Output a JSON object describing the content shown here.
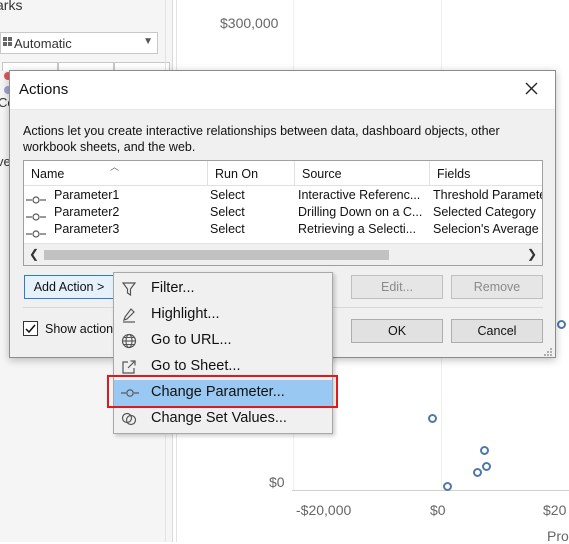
{
  "workspace": {
    "marks_title": "arks",
    "marks_type": "Automatic",
    "left_cut_labels": [
      "Co",
      "ve"
    ],
    "y_axis_labels": [
      "$300,000",
      "$0"
    ],
    "x_axis_labels": [
      "-$20,000",
      "$0",
      "$20"
    ],
    "x_axis_title_cut": "Pro"
  },
  "dialog": {
    "title": "Actions",
    "description": "Actions let you create interactive relationships between data, dashboard objects, other workbook sheets, and the web.",
    "columns": [
      "Name",
      "Run On",
      "Source",
      "Fields"
    ],
    "rows": [
      {
        "name": "Parameter1",
        "run_on": "Select",
        "source": "Interactive Referenc...",
        "fields": "Threshold Paramete"
      },
      {
        "name": "Parameter2",
        "run_on": "Select",
        "source": "Drilling Down on a C...",
        "fields": "Selected Category"
      },
      {
        "name": "Parameter3",
        "run_on": "Select",
        "source": "Retrieving a Selecti...",
        "fields": "Selecion's Average"
      }
    ],
    "add_action_label": "Add Action >",
    "edit_label": "Edit...",
    "remove_label": "Remove",
    "show_actions_label": "Show action",
    "ok_label": "OK",
    "cancel_label": "Cancel",
    "show_actions_checked": true
  },
  "menu": {
    "items": [
      {
        "label": "Filter...",
        "icon": "filter-icon"
      },
      {
        "label": "Highlight...",
        "icon": "highlight-icon"
      },
      {
        "label": "Go to URL...",
        "icon": "globe-icon"
      },
      {
        "label": "Go to Sheet...",
        "icon": "go-to-sheet-icon"
      },
      {
        "label": "Change Parameter...",
        "icon": "parameter-icon"
      },
      {
        "label": "Change Set Values...",
        "icon": "set-values-icon"
      }
    ],
    "highlighted": "Change Parameter..."
  },
  "colors": {
    "accent": "#2b7bd0",
    "menu_highlight": "#99c9f2",
    "callout": "#e0191c",
    "mark": "#4e79a7"
  }
}
